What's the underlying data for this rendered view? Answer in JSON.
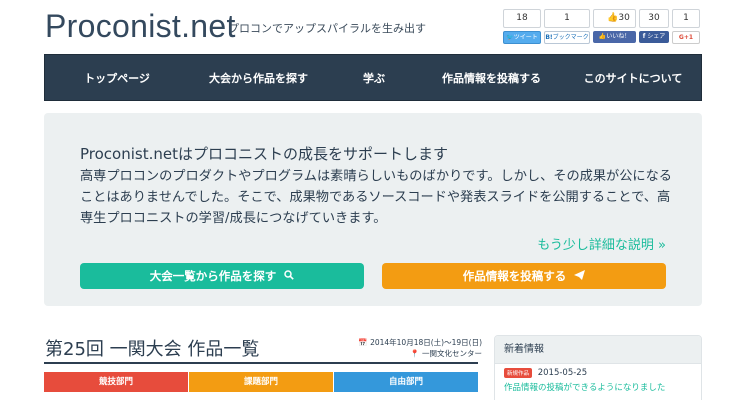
{
  "site": {
    "brand": "Proconist.net",
    "tagline": "プロコンでアップスパイラルを生み出す"
  },
  "social": [
    {
      "count": "18",
      "label": "ツイート",
      "icon": "twitter-bird-icon"
    },
    {
      "count": "1",
      "label": "ブックマーク",
      "icon": "hatena-b-icon"
    },
    {
      "count": "30",
      "label": "いいね！",
      "icon": "facebook-like-icon"
    },
    {
      "count": "30",
      "label": "シェア",
      "icon": "facebook-f-icon"
    },
    {
      "count": "1",
      "label": "G+1",
      "icon": "google-plus-icon"
    }
  ],
  "nav": [
    "トップページ",
    "大会から作品を探す",
    "学ぶ",
    "作品情報を投稿する",
    "このサイトについて"
  ],
  "hero": {
    "title": "Proconist.netはプロコニストの成長をサポートします",
    "body": "高専プロコンのプロダクトやプログラムは素晴らしいものばかりです。しかし、その成果が公になることはありませんでした。そこで、成果物であるソースコードや発表スライドを公開することで、高専生プロコニストの学習/成長につなげていきます。",
    "more": "もう少し詳細な説明 »",
    "btn_search": "大会一覧から作品を探す",
    "btn_post": "作品情報を投稿する"
  },
  "event": {
    "title": "第25回 一関大会 作品一覧",
    "date": "2014年10月18日(土)〜19日(日)",
    "venue": "一関文化センター",
    "tabs": [
      "競技部門",
      "課題部門",
      "自由部門"
    ]
  },
  "news": {
    "header": "新着情報",
    "badge": "新規作品",
    "date": "2015-05-25",
    "text": "作品情報の投稿ができるようになりました"
  },
  "colors": {
    "nav_bg": "#2c3e50",
    "accent_green": "#1abc9c",
    "accent_orange": "#f39c12",
    "accent_red": "#e74c3c",
    "accent_blue": "#3498db",
    "hero_bg": "#ecf0f1"
  }
}
